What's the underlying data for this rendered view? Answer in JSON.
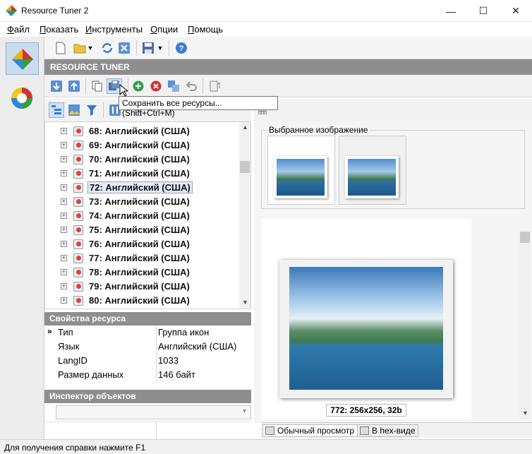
{
  "window": {
    "title": "Resource Tuner 2",
    "minimize_glyph": "—",
    "maximize_glyph": "☐",
    "close_glyph": "✕"
  },
  "menu": [
    {
      "label": "Файл",
      "accel": "Ф"
    },
    {
      "label": "Показать",
      "accel": "П"
    },
    {
      "label": "Инструменты",
      "accel": "И"
    },
    {
      "label": "Опции",
      "accel": "О"
    },
    {
      "label": "Помощь",
      "accel": "П"
    }
  ],
  "panel_header": "RESOURCE TUNER",
  "tooltip": "Сохранить все ресурсы... (Shift+Ctrl+M)",
  "tree": {
    "items": [
      {
        "label": "68: Английский (США)",
        "selected": false
      },
      {
        "label": "69: Английский (США)",
        "selected": false
      },
      {
        "label": "70: Английский (США)",
        "selected": false
      },
      {
        "label": "71: Английский (США)",
        "selected": false
      },
      {
        "label": "72: Английский (США)",
        "selected": true
      },
      {
        "label": "73: Английский (США)",
        "selected": false
      },
      {
        "label": "74: Английский (США)",
        "selected": false
      },
      {
        "label": "75: Английский (США)",
        "selected": false
      },
      {
        "label": "76: Английский (США)",
        "selected": false
      },
      {
        "label": "77: Английский (США)",
        "selected": false
      },
      {
        "label": "78: Английский (США)",
        "selected": false
      },
      {
        "label": "79: Английский (США)",
        "selected": false
      },
      {
        "label": "80: Английский (США)",
        "selected": false
      }
    ]
  },
  "properties": {
    "header": "Свойства ресурса",
    "rows": [
      {
        "key": "Тип",
        "value": "Группа икон"
      },
      {
        "key": "Язык",
        "value": "Английский (США)"
      },
      {
        "key": "LangID",
        "value": "1033"
      },
      {
        "key": "Размер данных",
        "value": "146 байт"
      }
    ]
  },
  "inspector": {
    "header": "Инспектор объектов"
  },
  "preview": {
    "group_label": "Выбранное изображение",
    "caption": "772: 256x256, 32b"
  },
  "bottom_tabs": [
    {
      "label": "Обычный просмотр",
      "active": true
    },
    {
      "label": "В hex-виде",
      "active": false
    }
  ],
  "status": "Для получения справки нажмите F1",
  "colors": {
    "header_gray": "#8e8e8e",
    "accent_blue": "#3a7bd5",
    "green": "#2ea043",
    "red": "#d63031"
  }
}
